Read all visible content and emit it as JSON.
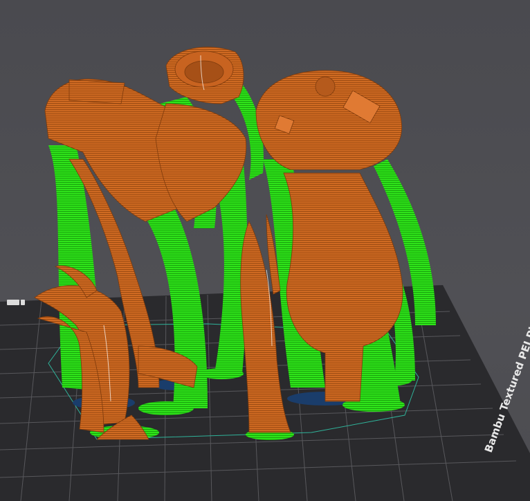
{
  "viewport": {
    "background_color": "#4d4d52",
    "plate_color": "#2a2a2d",
    "grid_color": "#58585c",
    "model_color": "#d06a22",
    "support_color": "#22dd11",
    "brim_color": "#1a3d6b",
    "boundary_color": "#2fb39a"
  },
  "build_plate": {
    "label": "Bambu Textured PEI Plate",
    "icon": "plate-logo-icon"
  }
}
